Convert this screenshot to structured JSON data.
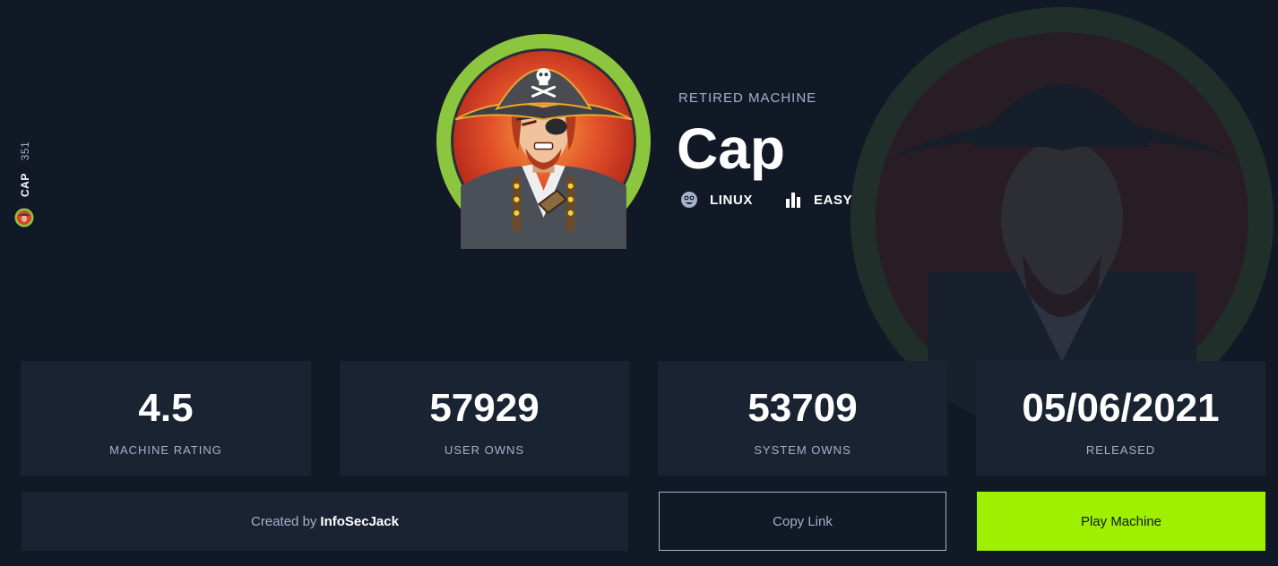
{
  "side": {
    "name": "CAP",
    "number": "351"
  },
  "machine": {
    "status": "RETIRED MACHINE",
    "name": "Cap",
    "os": "LINUX",
    "difficulty": "EASY"
  },
  "stats": [
    {
      "value": "4.5",
      "label": "MACHINE RATING"
    },
    {
      "value": "57929",
      "label": "USER OWNS"
    },
    {
      "value": "53709",
      "label": "SYSTEM OWNS"
    },
    {
      "value": "05/06/2021",
      "label": "RELEASED"
    }
  ],
  "footer": {
    "created_prefix": "Created by",
    "author": "InfoSecJack",
    "copy_label": "Copy Link",
    "play_label": "Play Machine"
  },
  "colors": {
    "background": "#111927",
    "card": "#1a2332",
    "accent": "#9fef00",
    "muted_text": "#a4b1cd",
    "avatar_ring": "#8cc63f"
  },
  "icons": {
    "os": "linux-icon",
    "difficulty": "difficulty-bars-icon"
  }
}
